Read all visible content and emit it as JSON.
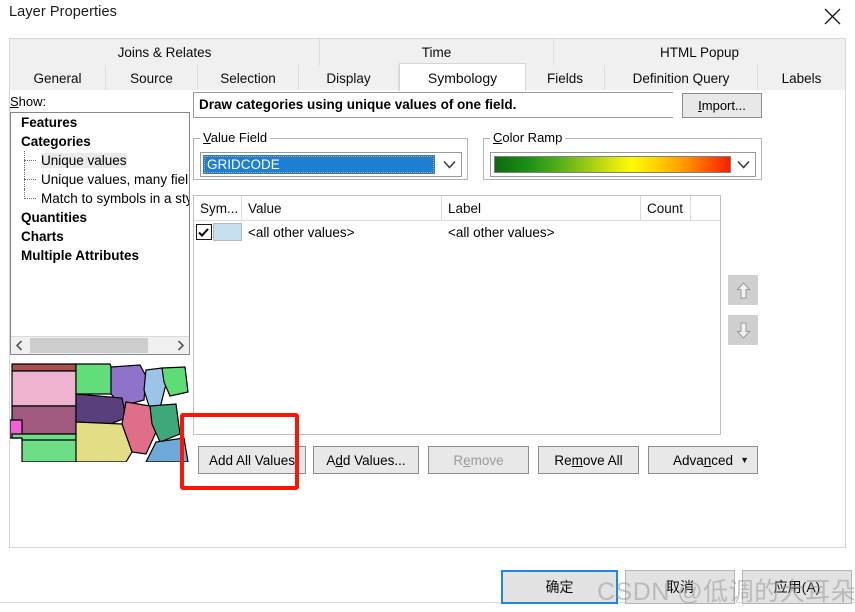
{
  "window": {
    "title": "Layer Properties",
    "close_icon": "close-icon"
  },
  "tabs": {
    "row1": [
      {
        "label": "Joins & Relates",
        "active": false
      },
      {
        "label": "Time",
        "active": false
      },
      {
        "label": "HTML Popup",
        "active": false
      }
    ],
    "row2": [
      {
        "label": "General",
        "active": false
      },
      {
        "label": "Source",
        "active": false
      },
      {
        "label": "Selection",
        "active": false
      },
      {
        "label": "Display",
        "active": false
      },
      {
        "label": "Symbology",
        "active": true
      },
      {
        "label": "Fields",
        "active": false
      },
      {
        "label": "Definition Query",
        "active": false
      },
      {
        "label": "Labels",
        "active": false
      }
    ]
  },
  "show": {
    "label": "Show:",
    "label_mnemonic": "S",
    "label_rest": "how:",
    "tree": [
      {
        "label": "Features",
        "bold": true,
        "child": false,
        "selected": false
      },
      {
        "label": "Categories",
        "bold": true,
        "child": false,
        "selected": false
      },
      {
        "label": "Unique values",
        "bold": false,
        "child": true,
        "selected": true
      },
      {
        "label": "Unique values, many fiel",
        "bold": false,
        "child": true,
        "selected": false
      },
      {
        "label": "Match to symbols in a sty",
        "bold": false,
        "child": true,
        "selected": false
      },
      {
        "label": "Quantities",
        "bold": true,
        "child": false,
        "selected": false
      },
      {
        "label": "Charts",
        "bold": true,
        "child": false,
        "selected": false
      },
      {
        "label": "Multiple Attributes",
        "bold": true,
        "child": false,
        "selected": false
      }
    ],
    "scroll_left_icon": "chevron-left-icon",
    "scroll_right_icon": "chevron-right-icon"
  },
  "description": "Draw categories using unique values of one field.",
  "import_button": {
    "label": "Import...",
    "mnemonic": "I",
    "rest": "mport..."
  },
  "value_field": {
    "legend": "Value Field",
    "legend_mnemonic": "V",
    "legend_rest": "alue Field",
    "selected": "GRIDCODE",
    "dropdown_icon": "chevron-down-icon"
  },
  "color_ramp": {
    "legend": "Color Ramp",
    "legend_mnemonic": "C",
    "legend_rest": "olor Ramp",
    "dropdown_icon": "chevron-down-icon",
    "gradient_stops": [
      "#0e6a0e",
      "#1d8f16",
      "#58b018",
      "#9fcc14",
      "#d9e60d",
      "#fdfa06",
      "#ffd600",
      "#ff9c00",
      "#ff5b00",
      "#f81e00"
    ]
  },
  "table": {
    "headers": {
      "symbol": "Sym...",
      "value": "Value",
      "label": "Label",
      "count": "Count"
    },
    "rows": [
      {
        "checked": true,
        "swatch_color": "#c7e0f0",
        "value": "<all other values>",
        "label": "<all other values>",
        "count": ""
      }
    ]
  },
  "reorder": {
    "up_icon": "arrow-up-icon",
    "down_icon": "arrow-down-icon"
  },
  "buttons": {
    "add_all_values": {
      "label": "Add All Values",
      "disabled": false,
      "highlighted": true
    },
    "add_values": {
      "label": "Add Values...",
      "mnemonic_before": "A",
      "mnemonic": "d",
      "mnemonic_after": "d Values...",
      "disabled": false
    },
    "remove": {
      "label": "Remove",
      "mnemonic_before": "R",
      "mnemonic": "e",
      "mnemonic_after": "move",
      "disabled": true
    },
    "remove_all": {
      "label": "Remove All",
      "mnemonic_before": "Re",
      "mnemonic": "m",
      "mnemonic_after": "ove All",
      "disabled": false
    },
    "advanced": {
      "label": "Advanced",
      "mnemonic_before": "Adva",
      "mnemonic": "n",
      "mnemonic_after": "ced",
      "disabled": false,
      "caret_icon": "caret-down-icon"
    }
  },
  "dialog_buttons": {
    "ok": "确定",
    "cancel": "取消",
    "apply": "应用(A)"
  },
  "watermark": "CSDN @低调的大耳朵图图",
  "map_preview": {
    "name": "layer-map-preview",
    "regions": [
      {
        "id": "north-strip",
        "fill": "#a8504f"
      },
      {
        "id": "pink-large",
        "fill": "#eeb4cf"
      },
      {
        "id": "mauve-band",
        "fill": "#a05a80"
      },
      {
        "id": "green-top",
        "fill": "#62dd7a"
      },
      {
        "id": "purple-wi",
        "fill": "#8f72c9"
      },
      {
        "id": "lightblue-mi",
        "fill": "#9cc3e8"
      },
      {
        "id": "green-right",
        "fill": "#66dd7b"
      },
      {
        "id": "darkpurple-ia",
        "fill": "#5a3f7d"
      },
      {
        "id": "rose-il",
        "fill": "#e06e88"
      },
      {
        "id": "teal-in",
        "fill": "#3fa87b"
      },
      {
        "id": "yellow-mo",
        "fill": "#e3de85"
      },
      {
        "id": "green-ks",
        "fill": "#6ddd88"
      },
      {
        "id": "magenta-edge",
        "fill": "#f061d6"
      },
      {
        "id": "blue-bottom",
        "fill": "#6fa9d9"
      },
      {
        "id": "green-oh",
        "fill": "#5ddd74"
      }
    ]
  }
}
